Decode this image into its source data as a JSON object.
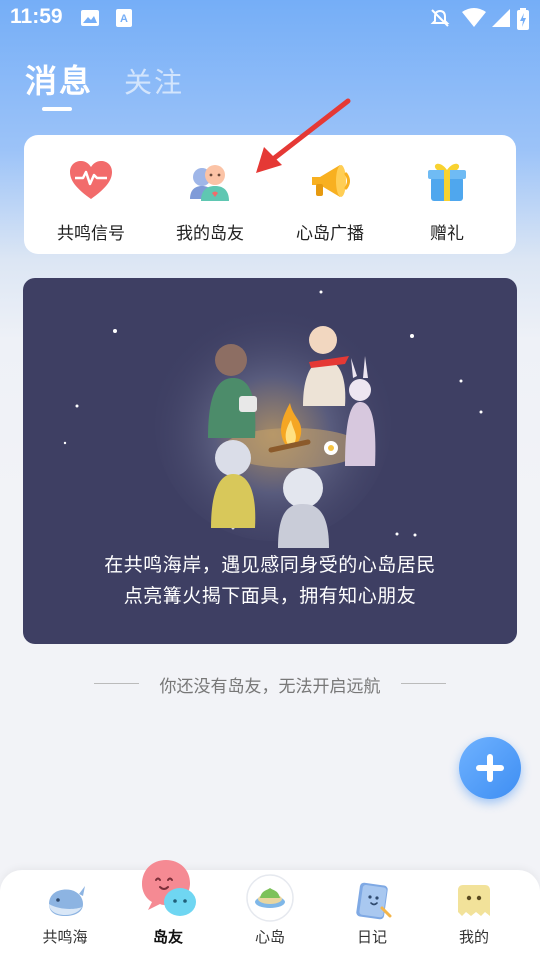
{
  "status_bar": {
    "time": "11:59",
    "icons": [
      "image-icon",
      "a-text-icon",
      "mute-icon",
      "wifi-icon",
      "signal-icon",
      "battery-charging-icon"
    ]
  },
  "header": {
    "tabs": [
      {
        "label": "消息",
        "active": true
      },
      {
        "label": "关注",
        "active": false
      }
    ]
  },
  "quick_actions": [
    {
      "label": "共鸣信号",
      "icon": "heart-pulse-icon"
    },
    {
      "label": "我的岛友",
      "icon": "friends-icon"
    },
    {
      "label": "心岛广播",
      "icon": "megaphone-icon"
    },
    {
      "label": "赠礼",
      "icon": "gift-icon"
    }
  ],
  "banner": {
    "line1": "在共鸣海岸，遇见感同身受的心岛居民",
    "line2": "点亮篝火揭下面具，拥有知心朋友",
    "image": "campfire-illustration"
  },
  "empty_hint": "你还没有岛友，无法开启远航",
  "fab": {
    "icon": "plus-icon"
  },
  "bottom_nav": [
    {
      "label": "共鸣海",
      "icon": "whale-icon",
      "active": false
    },
    {
      "label": "岛友",
      "icon": "island-friend-icon",
      "active": true
    },
    {
      "label": "心岛",
      "icon": "island-icon",
      "active": false
    },
    {
      "label": "日记",
      "icon": "diary-icon",
      "active": false
    },
    {
      "label": "我的",
      "icon": "profile-icon",
      "active": false
    }
  ],
  "colors": {
    "header_blue": "#75AEF7",
    "banner_bg": "#3E3F63",
    "fab_blue": "#3E8EF3",
    "heart_red": "#F26B6B"
  }
}
